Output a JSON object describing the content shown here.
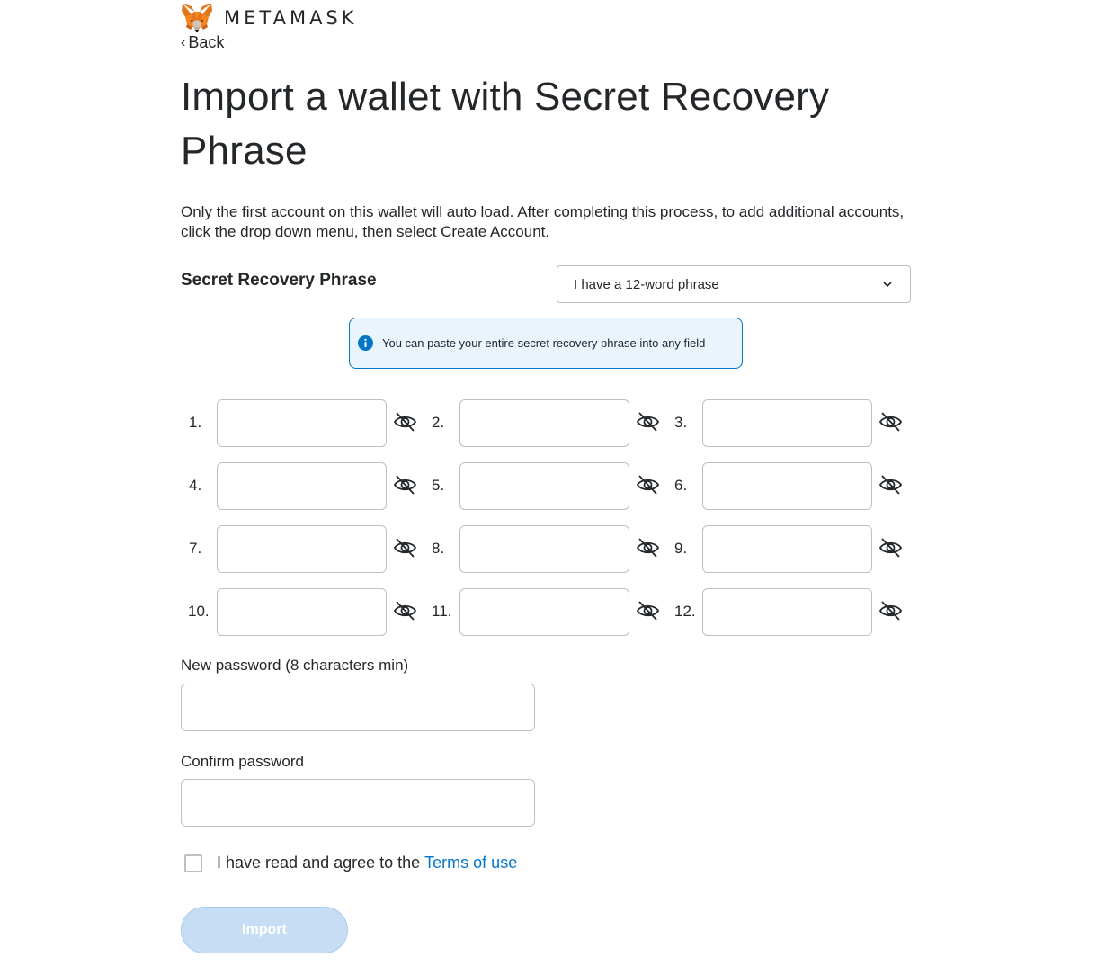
{
  "header": {
    "brand": "METAMASK",
    "back_label": "Back"
  },
  "page": {
    "title": "Import a wallet with Secret Recovery Phrase",
    "description": "Only the first account on this wallet will auto load. After completing this process, to add additional accounts, click the drop down menu, then select Create Account."
  },
  "srp": {
    "label": "Secret Recovery Phrase",
    "dropdown_value": "I have a 12-word phrase",
    "info_text": "You can paste your entire secret recovery phrase into any field",
    "words": [
      {
        "num": "1."
      },
      {
        "num": "2."
      },
      {
        "num": "3."
      },
      {
        "num": "4."
      },
      {
        "num": "5."
      },
      {
        "num": "6."
      },
      {
        "num": "7."
      },
      {
        "num": "8."
      },
      {
        "num": "9."
      },
      {
        "num": "10."
      },
      {
        "num": "11."
      },
      {
        "num": "12."
      }
    ]
  },
  "password": {
    "new_label": "New password (8 characters min)",
    "new_value": "",
    "confirm_label": "Confirm password",
    "confirm_value": ""
  },
  "terms": {
    "text": "I have read and agree to the",
    "link": "Terms of use",
    "checked": false
  },
  "import_button": {
    "label": "Import",
    "disabled": true
  },
  "colors": {
    "accent": "#0376c9",
    "button_disabled": "#c6ddf4",
    "border": "#bbc0c5",
    "info_bg": "#eaf4fd"
  },
  "icons": {
    "info": "info-icon",
    "eye": "eye-slash-icon",
    "dropdown": "chevron-down-icon",
    "logo": "metamask-fox-logo"
  }
}
